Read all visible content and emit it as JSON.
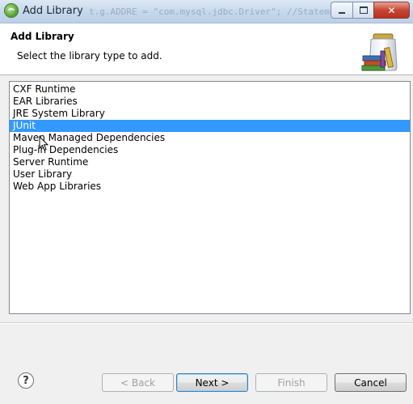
{
  "window": {
    "title": "Add Library",
    "background_text": "t.g.ADDRE = \"com.mysql.jdbc.Driver\"; //Statement",
    "close_glyph": "✕"
  },
  "header": {
    "title": "Add Library",
    "description": "Select the library type to add."
  },
  "library_list": {
    "items": [
      "CXF Runtime",
      "EAR Libraries",
      "JRE System Library",
      "JUnit",
      "Maven Managed Dependencies",
      "Plug-in Dependencies",
      "Server Runtime",
      "User Library",
      "Web App Libraries"
    ],
    "selected": "JUnit"
  },
  "buttons": {
    "help": "?",
    "back": "< Back",
    "next": "Next >",
    "finish": "Finish",
    "cancel": "Cancel"
  },
  "icons": {
    "app": "eclipse-spring-icon",
    "header": "library-jar-books-icon",
    "help": "help-icon",
    "cursor": "mouse-cursor-icon"
  },
  "colors": {
    "selection": "#3399ff",
    "titlebar": "#c4d6ea",
    "close_button": "#c74533"
  }
}
